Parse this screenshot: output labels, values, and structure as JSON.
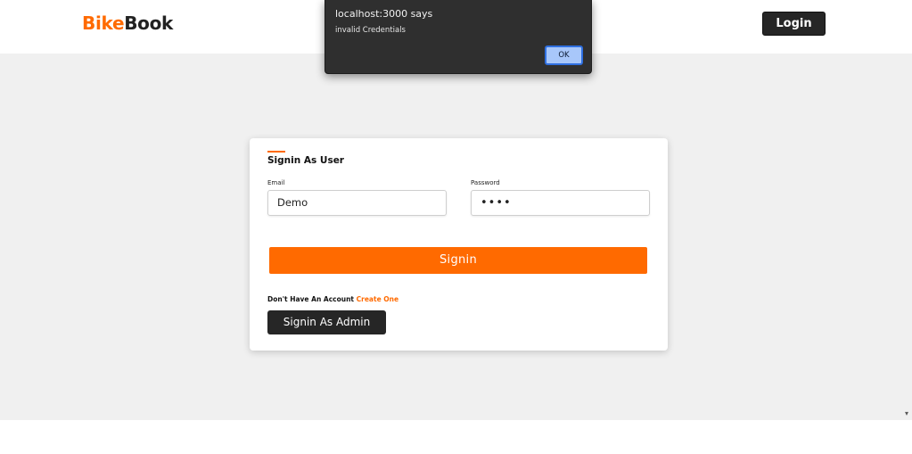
{
  "header": {
    "logo_part1": "Bike",
    "logo_part2": "Book",
    "login_label": "Login"
  },
  "signin_form": {
    "title": "Signin As User",
    "email_label": "Email",
    "email_value": "Demo",
    "password_label": "Password",
    "password_value": "••••",
    "signin_label": "Signin",
    "no_account_text": "Don't Have An Account",
    "create_link": "Create One",
    "admin_button": "Signin As Admin"
  },
  "alert": {
    "title": "localhost:3000 says",
    "message": "invalid Credentials",
    "ok_label": "OK"
  },
  "colors": {
    "accent": "#ff6a00",
    "dark": "#262626",
    "band": "#f0f0f0"
  }
}
